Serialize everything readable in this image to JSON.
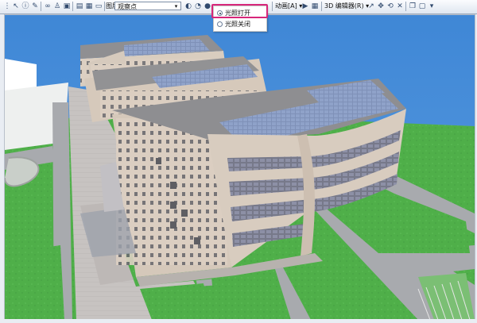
{
  "toolbar": {
    "layer_label": "图层:",
    "layer_value": "观察点",
    "animation_label": "动画[A] ▾",
    "editor_label": "3D 编辑器(R) ▾"
  },
  "light_menu": {
    "items": [
      {
        "label": "光照打开",
        "selected": true
      },
      {
        "label": "光照关闭",
        "selected": false
      }
    ]
  },
  "colors": {
    "highlight": "#d7267a",
    "sky": "#4b8fd8",
    "grass": "#4fb04c",
    "road": "#a9acb1",
    "building_wall": "#d8cdc1",
    "roof": "#8d8d8f",
    "solar_panel": "#7e8fb7"
  },
  "icons": [
    "pointer-icon",
    "info-icon",
    "pen-icon",
    "binoculars-icon",
    "layers-icon",
    "zoom-icon",
    "navigate-icon",
    "play-icon",
    "lighting-icon"
  ]
}
